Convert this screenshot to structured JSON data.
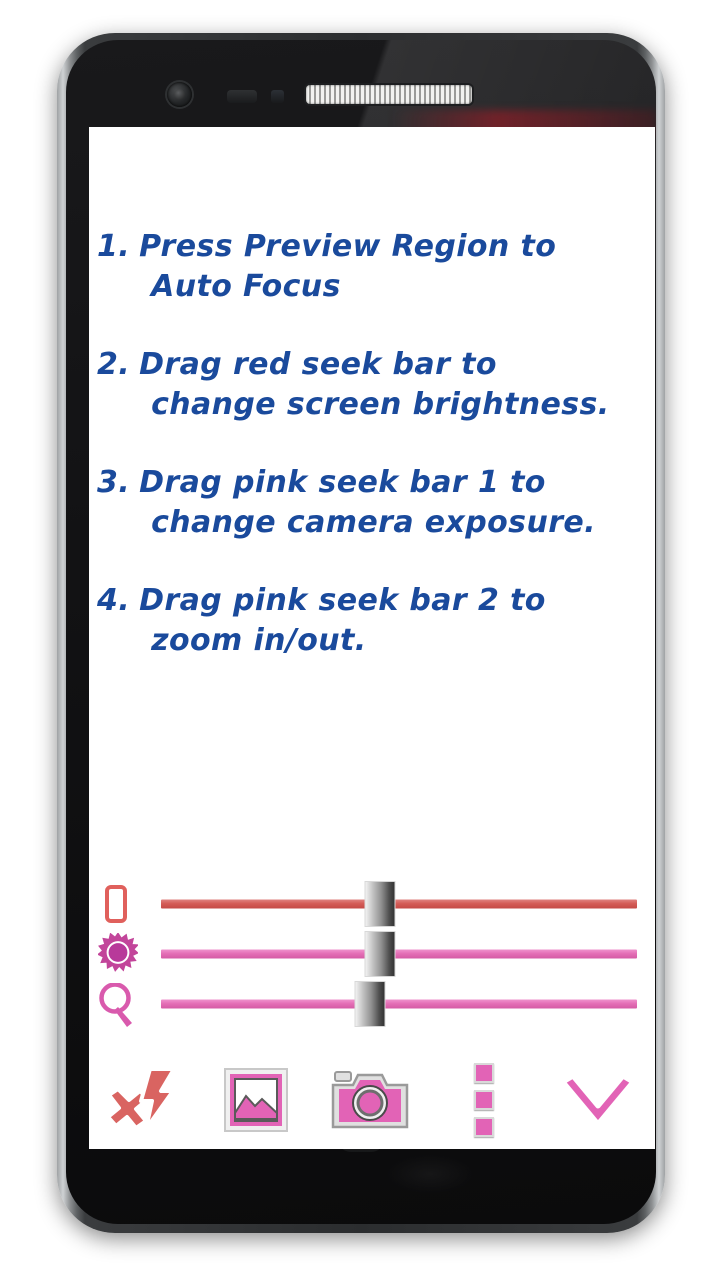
{
  "app": {
    "screen_background": "#ffffff",
    "text_color": "#1a4a9c"
  },
  "instructions": [
    {
      "number": "1.",
      "line1": "Press Preview Region to",
      "line2": "Auto Focus"
    },
    {
      "number": "2.",
      "line1": "Drag red seek bar to",
      "line2": "change screen brightness."
    },
    {
      "number": "3.",
      "line1": "Drag pink seek bar 1 to",
      "line2": "change camera exposure."
    },
    {
      "number": "4.",
      "line1": "Drag pink seek bar 2 to",
      "line2": "zoom in/out."
    }
  ],
  "sliders": [
    {
      "name": "screen-brightness",
      "icon": "phone-icon",
      "color": "#d45c57",
      "value_percent": 50
    },
    {
      "name": "camera-exposure",
      "icon": "sun-icon",
      "color": "#e46fb6",
      "value_percent": 50
    },
    {
      "name": "camera-zoom",
      "icon": "magnifier-icon",
      "color": "#e46fb6",
      "value_percent": 48
    }
  ],
  "toolbar": [
    {
      "name": "flash-off-button",
      "icon": "flash-off-icon"
    },
    {
      "name": "gallery-button",
      "icon": "picture-icon"
    },
    {
      "name": "shutter-button",
      "icon": "camera-icon"
    },
    {
      "name": "overflow-menu-button",
      "icon": "three-dots-icon"
    },
    {
      "name": "collapse-button",
      "icon": "chevron-down-icon"
    }
  ],
  "device": {
    "front_camera": "front-camera",
    "speaker": "earpiece-speaker",
    "accent_pink": "#e263b6",
    "accent_red": "#d45c57"
  }
}
